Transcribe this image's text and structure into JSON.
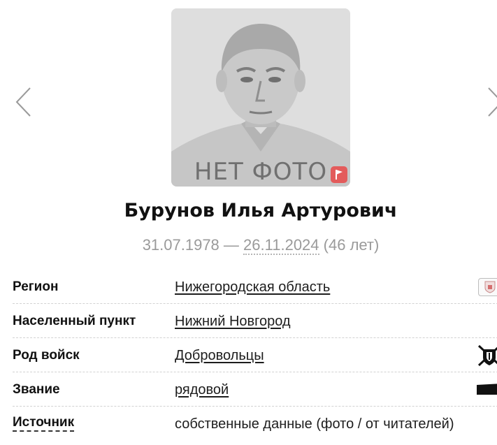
{
  "photo": {
    "caption": "НЕТ ФОТО",
    "report_icon": "flag-icon"
  },
  "navigation": {
    "prev_icon": "chevron-left-icon",
    "next_icon": "chevron-right-icon"
  },
  "person": {
    "name": "Бурунов Илья Артурович",
    "birth_date": "31.07.1978",
    "separator": "—",
    "death_date": "26.11.2024",
    "age": "(46 лет)"
  },
  "details": {
    "region": {
      "label": "Регион",
      "value": "Нижегородская область",
      "icon": "region-coat-of-arms-icon"
    },
    "settlement": {
      "label": "Населенный пункт",
      "value": "Нижний Новгород"
    },
    "troops": {
      "label": "Род войск",
      "value": "Добровольцы",
      "icon": "volunteers-emblem-icon"
    },
    "rank": {
      "label": "Звание",
      "value": "рядовой",
      "icon": "rank-insignia-icon"
    },
    "source": {
      "label": "Источник",
      "value": "собственные данные (фото / от читателей)"
    }
  },
  "colors": {
    "flag_badge": "#e35b5b",
    "muted_text": "#9a9a9a",
    "text": "#111111"
  }
}
